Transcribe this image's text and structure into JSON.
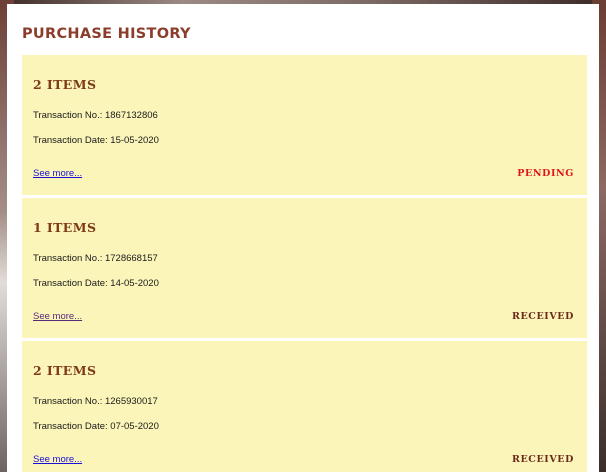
{
  "page": {
    "title": "PURCHASE HISTORY"
  },
  "labels": {
    "transaction_no": "Transaction No.:",
    "transaction_date": "Transaction Date:",
    "see_more": "See more..."
  },
  "colors": {
    "title": "#8b3c2a",
    "card_bg": "#fbf5b9",
    "status_pending": "#e0161b",
    "status_received": "#6b2b1a"
  },
  "purchases": [
    {
      "count": "2 ITEMS",
      "transaction_no": "1867132806",
      "transaction_date": "15-05-2020",
      "status": "PENDING"
    },
    {
      "count": "1 ITEMS",
      "transaction_no": "1728668157",
      "transaction_date": "14-05-2020",
      "status": "RECEIVED"
    },
    {
      "count": "2 ITEMS",
      "transaction_no": "1265930017",
      "transaction_date": "07-05-2020",
      "status": "RECEIVED"
    }
  ]
}
